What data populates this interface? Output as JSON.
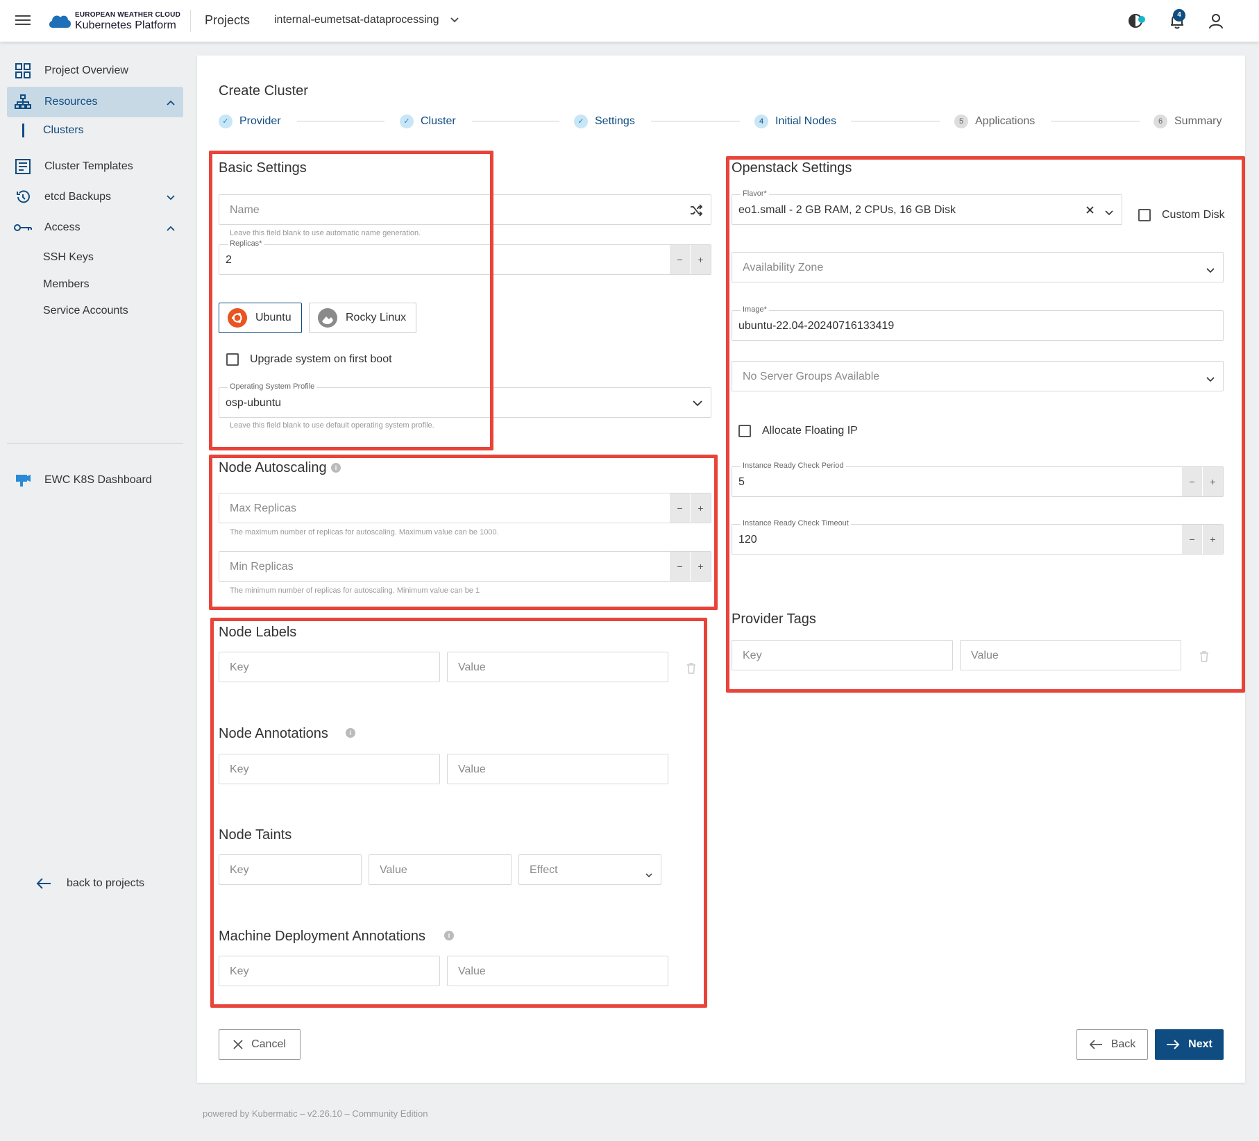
{
  "header": {
    "logo_top": "EUROPEAN WEATHER CLOUD",
    "logo_bottom": "Kubernetes Platform",
    "projects_label": "Projects",
    "project_name": "internal-eumetsat-dataprocessing",
    "notification_count": "4"
  },
  "sidebar": {
    "items": [
      {
        "label": "Project Overview",
        "icon": "grid-icon"
      },
      {
        "label": "Resources",
        "icon": "sitemap-icon"
      },
      {
        "label": "Clusters"
      },
      {
        "label": "Cluster Templates",
        "icon": "template-icon"
      },
      {
        "label": "etcd Backups",
        "icon": "history-icon"
      },
      {
        "label": "Access",
        "icon": "key-icon"
      },
      {
        "label": "SSH Keys"
      },
      {
        "label": "Members"
      },
      {
        "label": "Service Accounts"
      },
      {
        "label": "EWC K8S Dashboard",
        "icon": "dashboard-icon"
      }
    ],
    "back_label": "back to projects"
  },
  "page": {
    "title": "Create Cluster",
    "steps": [
      {
        "num": "✓",
        "label": "Provider",
        "state": "done"
      },
      {
        "num": "✓",
        "label": "Cluster",
        "state": "done"
      },
      {
        "num": "✓",
        "label": "Settings",
        "state": "done"
      },
      {
        "num": "4",
        "label": "Initial Nodes",
        "state": "current"
      },
      {
        "num": "5",
        "label": "Applications",
        "state": "future"
      },
      {
        "num": "6",
        "label": "Summary",
        "state": "future"
      }
    ]
  },
  "basic": {
    "title": "Basic Settings",
    "name_placeholder": "Name",
    "name_hint": "Leave this field blank to use automatic name generation.",
    "replicas_label": "Replicas*",
    "replicas_value": "2",
    "os_ubuntu": "Ubuntu",
    "os_rocky": "Rocky Linux",
    "upgrade_label": "Upgrade system on first boot",
    "osp_label": "Operating System Profile",
    "osp_value": "osp-ubuntu",
    "osp_hint": "Leave this field blank to use default operating system profile."
  },
  "autoscaling": {
    "title": "Node Autoscaling",
    "max_placeholder": "Max Replicas",
    "max_hint": "The maximum number of replicas for autoscaling. Maximum value can be 1000.",
    "min_placeholder": "Min Replicas",
    "min_hint": "The minimum number of replicas for autoscaling. Minimum value can be 1"
  },
  "labels": {
    "labels_title": "Node Labels",
    "annotations_title": "Node Annotations",
    "taints_title": "Node Taints",
    "md_annotations_title": "Machine Deployment Annotations",
    "key_placeholder": "Key",
    "value_placeholder": "Value",
    "effect_placeholder": "Effect"
  },
  "openstack": {
    "title": "Openstack Settings",
    "flavor_label": "Flavor*",
    "flavor_value": "eo1.small - 2 GB RAM, 2 CPUs, 16 GB Disk",
    "custom_disk": "Custom Disk",
    "az_placeholder": "Availability Zone",
    "image_label": "Image*",
    "image_value": "ubuntu-22.04-20240716133419",
    "server_groups_placeholder": "No Server Groups Available",
    "floating_ip": "Allocate Floating IP",
    "check_period_label": "Instance Ready Check Period",
    "check_period_value": "5",
    "check_timeout_label": "Instance Ready Check Timeout",
    "check_timeout_value": "120",
    "provider_tags_title": "Provider Tags",
    "key_placeholder": "Key",
    "value_placeholder": "Value"
  },
  "actions": {
    "cancel": "Cancel",
    "back": "Back",
    "next": "Next"
  },
  "footer": {
    "text": "powered by Kubermatic –  v2.26.10 –  Community Edition"
  },
  "colors": {
    "primary": "#0f4c81",
    "highlight": "#e8443a",
    "active_nav": "#c8d9e6"
  }
}
